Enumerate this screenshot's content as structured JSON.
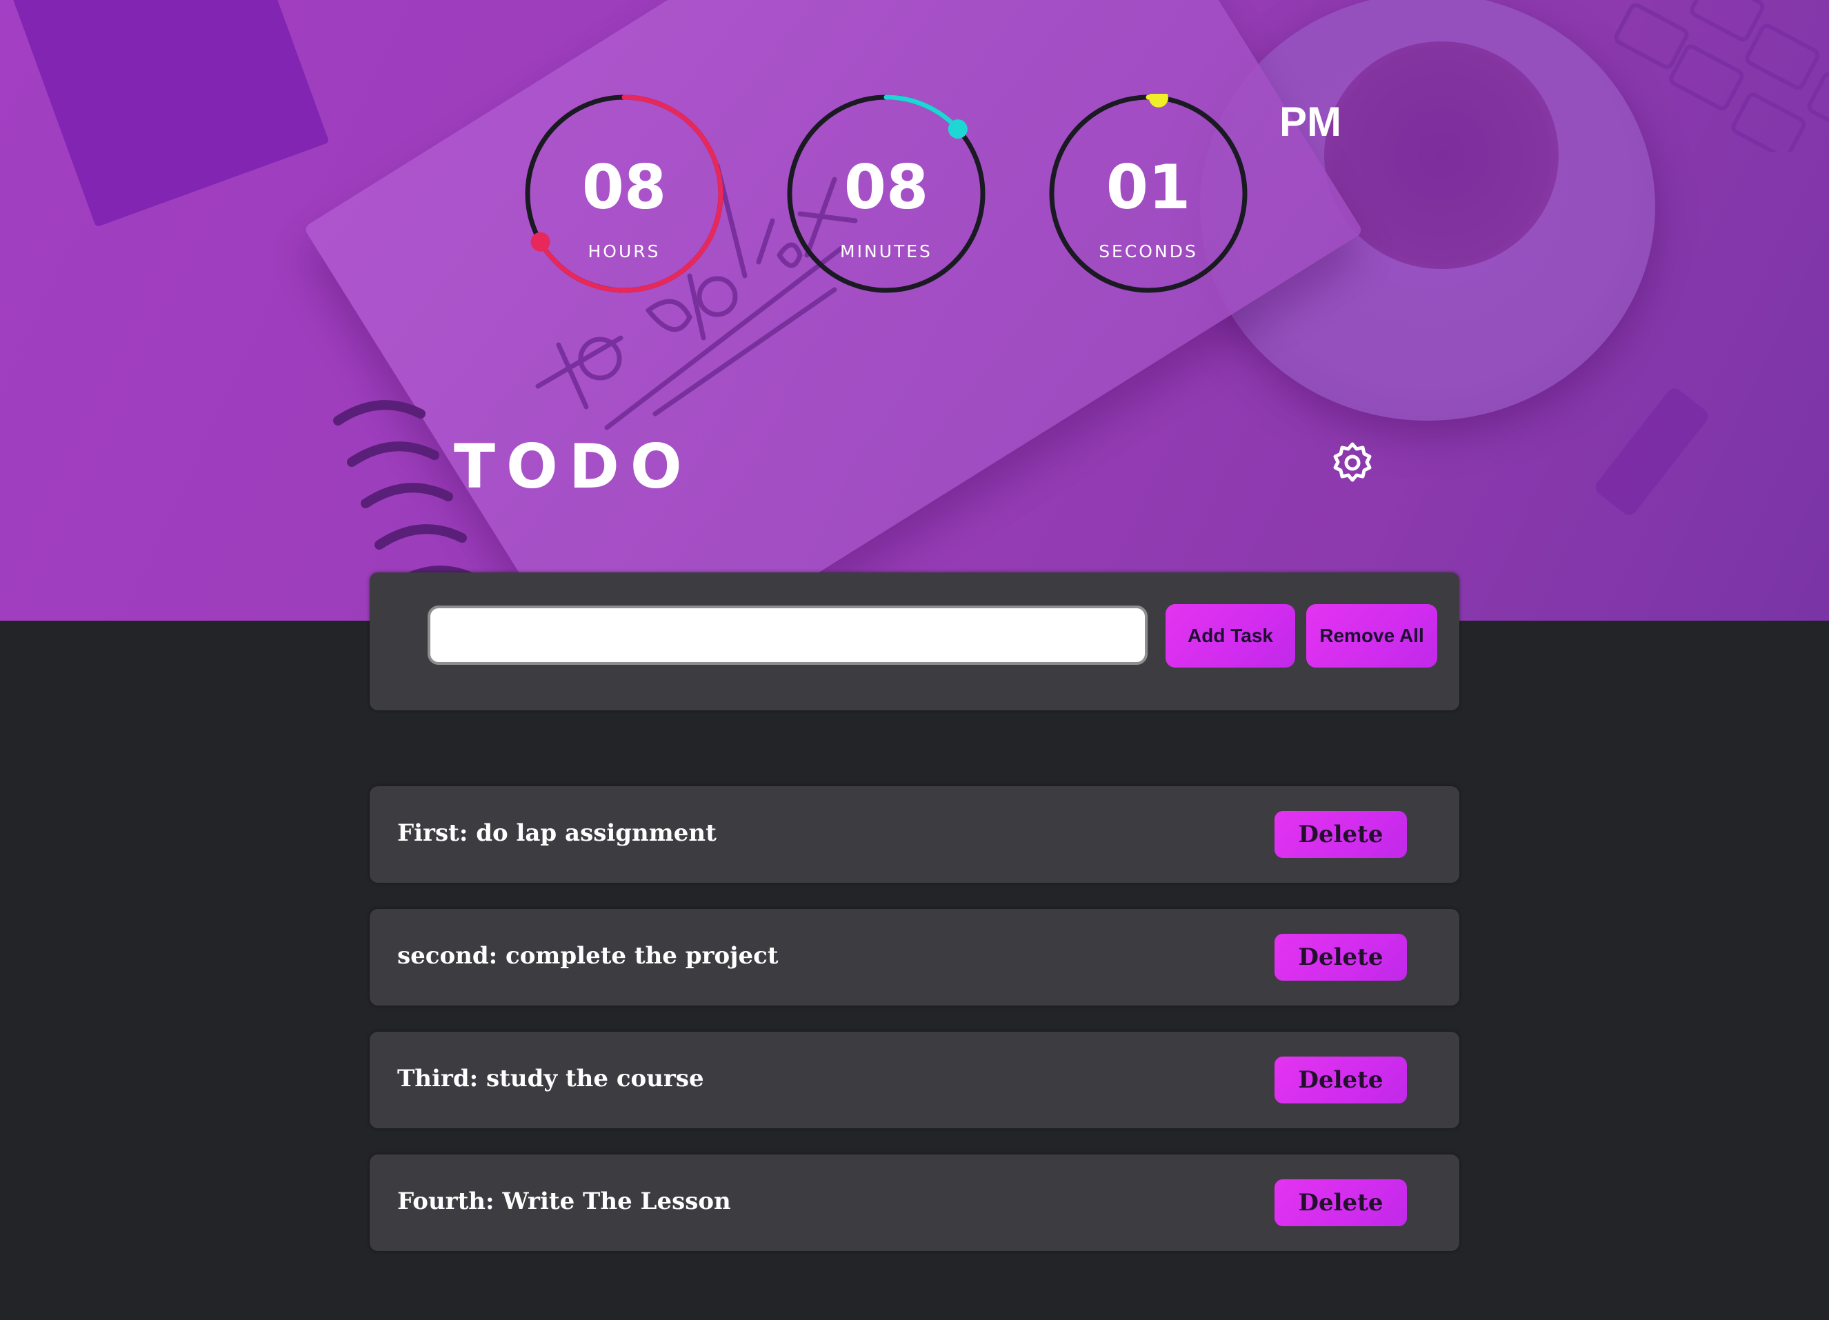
{
  "app": {
    "title": "TODO",
    "meridiem": "PM"
  },
  "clock": {
    "hours": {
      "value": "08",
      "label": "HOURS",
      "fraction": 0.667,
      "color": "#e8285a"
    },
    "minutes": {
      "value": "08",
      "label": "MINUTES",
      "fraction": 0.133,
      "color": "#1ed6d4"
    },
    "seconds": {
      "value": "01",
      "label": "SECONDS",
      "fraction": 0.017,
      "color": "#f0f02a"
    }
  },
  "input": {
    "value": "",
    "placeholder": ""
  },
  "buttons": {
    "add": "Add Task",
    "remove_all": "Remove All",
    "delete": "Delete"
  },
  "tasks": [
    {
      "text": "First: do lap assignment"
    },
    {
      "text": "second: complete the project"
    },
    {
      "text": "Third: study the course"
    },
    {
      "text": "Fourth: Write The Lesson"
    }
  ],
  "colors": {
    "accent": "#d62ef0",
    "panel": "#3d3c41",
    "background": "#222428",
    "hero": "#9a3db9"
  },
  "icons": {
    "settings": "gear-icon"
  }
}
